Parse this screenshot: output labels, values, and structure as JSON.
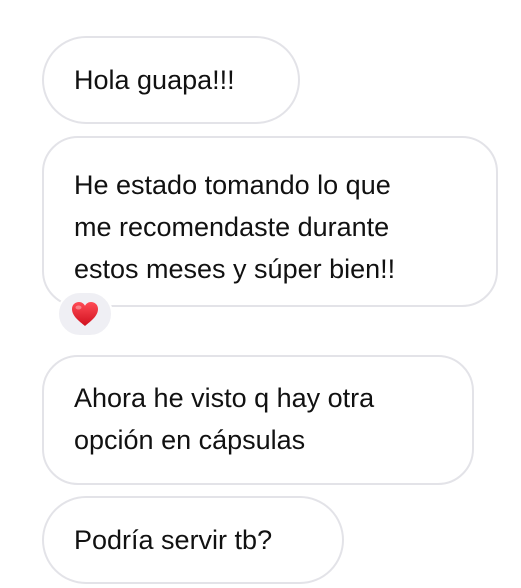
{
  "messages": [
    {
      "lines": [
        "Hola guapa!!!"
      ]
    },
    {
      "lines": [
        "He estado tomando lo que",
        "me recomendaste durante",
        "estos meses y súper bien!!"
      ],
      "reaction": "red-heart-icon"
    },
    {
      "lines": [
        "Ahora he visto q hay otra",
        "opción en cápsulas"
      ]
    },
    {
      "lines": [
        "Podría servir tb?"
      ]
    }
  ],
  "colors": {
    "bubble_border": "#e3e3e8",
    "reaction_bg": "#efeff4",
    "heart": "#e0202e"
  }
}
